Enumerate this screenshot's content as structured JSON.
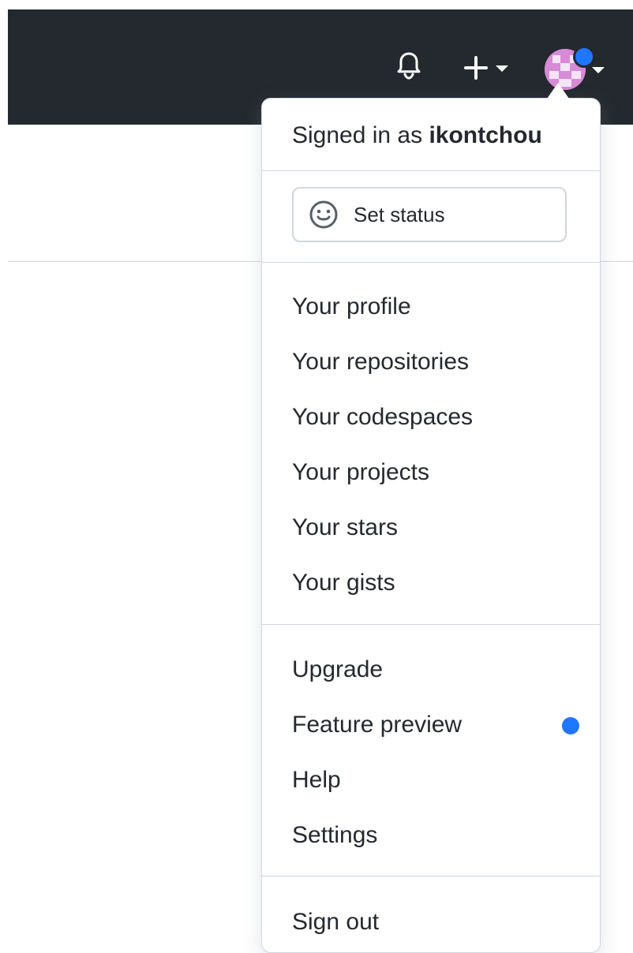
{
  "topbar": {
    "notifications_icon": "bell-icon",
    "create_icon": "plus-icon",
    "create_caret_icon": "chevron-down-icon",
    "avatar_icon": "user-avatar-icon"
  },
  "menu": {
    "signed_in_prefix": "Signed in as ",
    "username": "ikontchou",
    "set_status": "Set status",
    "items": [
      "Your profile",
      "Your repositories",
      "Your codespaces",
      "Your projects",
      "Your stars",
      "Your gists",
      "Upgrade",
      "Feature preview",
      "Help",
      "Settings",
      "Sign out"
    ]
  },
  "colors": {
    "header_bg": "#24292f",
    "accent_blue": "#1f77ff",
    "avatar_bg": "#d78ad6",
    "border": "#d0d7de",
    "text": "#24292f"
  }
}
